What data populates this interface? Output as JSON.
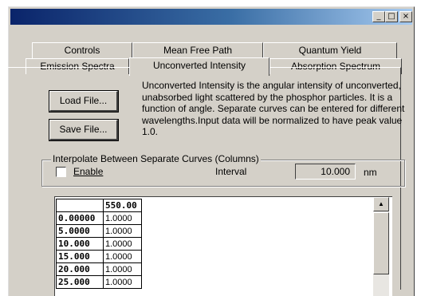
{
  "window": {
    "controls": {
      "minimize": "_",
      "maximize": "□",
      "close": "×"
    }
  },
  "tabs": {
    "row1": [
      "Controls",
      "Mean Free Path",
      "Quantum Yield"
    ],
    "row2": [
      "Emission Spectra",
      "Unconverted Intensity",
      "Absorption Spectrum"
    ],
    "active": "Unconverted Intensity"
  },
  "buttons": {
    "load_file": "Load File...",
    "save_file": "Save File..."
  },
  "description": "Unconverted Intensity is the angular intensity of unconverted, unabsorbed light scattered by the phosphor particles. It is a function of angle. Separate curves can be entered for different wavelengths.Input data will be normalized to have peak value 1.0.",
  "interpolate": {
    "legend": "Interpolate Between Separate Curves (Columns)",
    "enable_label": "Enable",
    "enable_checked": false,
    "interval_label": "Interval",
    "interval_value": "10.000",
    "interval_unit": "nm"
  },
  "grid": {
    "column_header": "550.00",
    "rows": [
      {
        "angle": "0.00000",
        "value": "1.0000"
      },
      {
        "angle": "5.0000",
        "value": "1.0000"
      },
      {
        "angle": "10.000",
        "value": "1.0000"
      },
      {
        "angle": "15.000",
        "value": "1.0000"
      },
      {
        "angle": "20.000",
        "value": "1.0000"
      },
      {
        "angle": "25.000",
        "value": "1.0000"
      }
    ]
  }
}
